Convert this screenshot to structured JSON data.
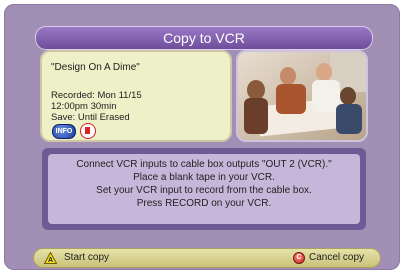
{
  "header": {
    "title": "Copy to VCR"
  },
  "program": {
    "title": "\"Design On A Dime\"",
    "recorded": "Recorded: Mon 11/15",
    "time": "12:00pm  30min",
    "save": "Save: Until Erased",
    "info_label": "INFO"
  },
  "instructions": {
    "lines": [
      "Connect VCR inputs to cable box outputs \"OUT 2 (VCR).\"",
      "Place a blank tape in your VCR.",
      "Set your VCR input to record from the cable box.",
      "Press RECORD on your VCR."
    ]
  },
  "footer": {
    "start_key": "A",
    "start_label": "Start copy",
    "cancel_key": "C",
    "cancel_label": "Cancel copy"
  },
  "colors": {
    "frame": "#a18fb6",
    "title_bar": "#7a58a6",
    "info_panel": "#eef0c8",
    "message_border": "#6f5a95",
    "footer": "#d6cf8e"
  }
}
